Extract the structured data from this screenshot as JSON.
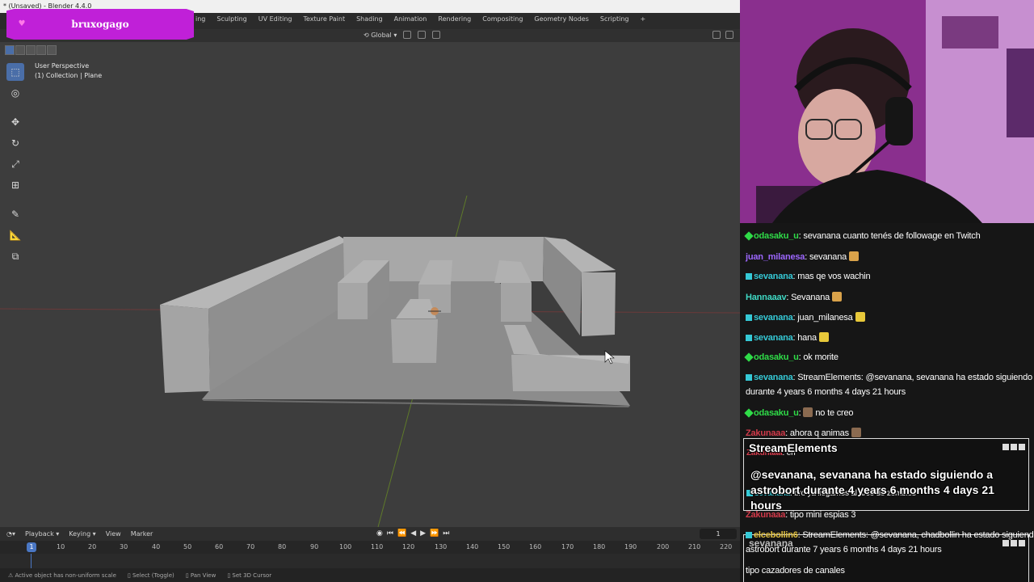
{
  "window": {
    "title": "* (Unsaved) - Blender 4.4.0"
  },
  "streamer_badge": {
    "name": "bruxogago"
  },
  "workspace_tabs": [
    "ing",
    "Sculpting",
    "UV Editing",
    "Texture Paint",
    "Shading",
    "Animation",
    "Rendering",
    "Compositing",
    "Geometry Nodes",
    "Scripting",
    "+"
  ],
  "header": {
    "orientation": "Global"
  },
  "viewport": {
    "view_name": "User Perspective",
    "collection": "(1) Collection | Plane"
  },
  "toolbar": {
    "icons": [
      "select-box-icon",
      "cursor-icon",
      "move-icon",
      "rotate-icon",
      "scale-icon",
      "transform-icon",
      "annotate-icon",
      "measure-icon",
      "add-cube-icon"
    ]
  },
  "timeline": {
    "menu": [
      "Playback",
      "Keying",
      "View",
      "Marker"
    ],
    "current_frame": "1",
    "ruler_start": "1",
    "ruler_ticks": [
      "10",
      "20",
      "30",
      "40",
      "50",
      "60",
      "70",
      "80",
      "90",
      "100",
      "110",
      "120",
      "130",
      "140",
      "150",
      "160",
      "170",
      "180",
      "190",
      "200",
      "210",
      "220"
    ]
  },
  "statusbar": {
    "items": [
      "Active object has non-uniform scale",
      "Select (Toggle)",
      "Pan View",
      "Set 3D Cursor"
    ]
  },
  "chat": {
    "messages": [
      {
        "user": "odasaku_u",
        "color": "#2fdc48",
        "badge": "green",
        "text": "sevanana cuanto tenés de followage en Twitch"
      },
      {
        "user": "juan_milanesa",
        "color": "#9d67ff",
        "badge": "",
        "text": "sevanana"
      },
      {
        "user": "sevanana",
        "color": "#35c9d6",
        "badge": "teal",
        "text": "mas qe vos wachin"
      },
      {
        "user": "Hannaaav",
        "color": "#3fd9c4",
        "badge": "",
        "text": "Sevanana"
      },
      {
        "user": "sevanana",
        "color": "#35c9d6",
        "badge": "teal",
        "text": "juan_milanesa"
      },
      {
        "user": "sevanana",
        "color": "#35c9d6",
        "badge": "teal",
        "text": "hana"
      },
      {
        "user": "odasaku_u",
        "color": "#2fdc48",
        "badge": "green",
        "text": "ok morite"
      },
      {
        "user": "sevanana",
        "color": "#35c9d6",
        "badge": "teal",
        "text": "StreamElements: @sevanana, sevanana ha estado siguiendo a astrobort"
      },
      {
        "user": "",
        "color": "#ffffff",
        "badge": "",
        "text": "durante 4 years 6 months 4 days 21 hours"
      },
      {
        "user": "odasaku_u",
        "color": "#2fdc48",
        "badge": "green",
        "text": "no te creo"
      },
      {
        "user": "Zakunaaa",
        "color": "#d23a4a",
        "badge": "",
        "text": "ahora q animas"
      },
      {
        "user": "Zakunaaa",
        "color": "#d23a4a",
        "badge": "",
        "text": "en"
      },
      {
        "user": "sevanana",
        "color": "#35c9d6",
        "badge": "teal",
        "text": "bro ya llegamos al arco de zombies"
      },
      {
        "user": "Zakunaaa",
        "color": "#d23a4a",
        "badge": "",
        "text": "tipo mini espias 3"
      },
      {
        "user": "elcebollin6",
        "color": "#e0c040",
        "badge": "teal",
        "text": "StreamElements: @sevanana, chadbollin ha estado siguiendo a"
      },
      {
        "user": "",
        "color": "#ffffff",
        "badge": "",
        "text": "astrobort durante 7 years 6 months 4 days 21 hours"
      },
      {
        "user": "",
        "color": "#ffffff",
        "badge": "",
        "text": "tipo cazadores de canales"
      }
    ],
    "popup": {
      "title": "StreamElements",
      "body": "@sevanana, sevanana ha estado siguiendo a astrobort durante 4 years 6 months 4 days 21 hours"
    },
    "popup2": {
      "title": "sevanana"
    }
  }
}
